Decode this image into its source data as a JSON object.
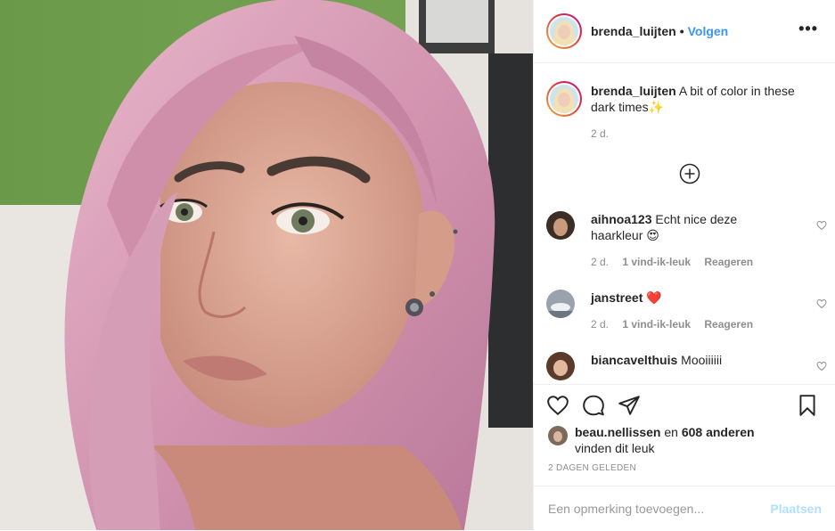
{
  "post": {
    "author": "brenda_luijten",
    "separator": "•",
    "follow_label": "Volgen",
    "more_icon": "more-options-icon",
    "more_label": "•••"
  },
  "caption": {
    "username": "brenda_luijten",
    "text": "A bit of color in these dark times",
    "emoji": "✨",
    "time": "2 d."
  },
  "load_more_icon": "plus-circle-icon",
  "comments": [
    {
      "username": "aihnoa123",
      "text": "Echt nice deze haarkleur",
      "emoji": "😍",
      "time": "2 d.",
      "likes": "1 vind-ik-leuk",
      "reply": "Reageren"
    },
    {
      "username": "janstreet",
      "text": "",
      "emoji": "❤️",
      "time": "2 d.",
      "likes": "1 vind-ik-leuk",
      "reply": "Reageren"
    },
    {
      "username": "biancavelthuis",
      "text": "Mooiiiiii",
      "emoji": ""
    }
  ],
  "likes": {
    "first_liker": "beau.nellissen",
    "and_word": "en",
    "others": "608 anderen",
    "suffix": "vinden dit leuk"
  },
  "posted_ago": "2 DAGEN GELEDEN",
  "comment_box": {
    "placeholder": "Een opmerking toevoegen...",
    "submit_label": "Plaatsen"
  },
  "colors": {
    "link": "#3897f0",
    "text": "#262626",
    "secondary": "#8e8e8e",
    "disabled_button": "#b2dffc",
    "hair": "#d99bb4",
    "wall": "#6f9a4e"
  }
}
